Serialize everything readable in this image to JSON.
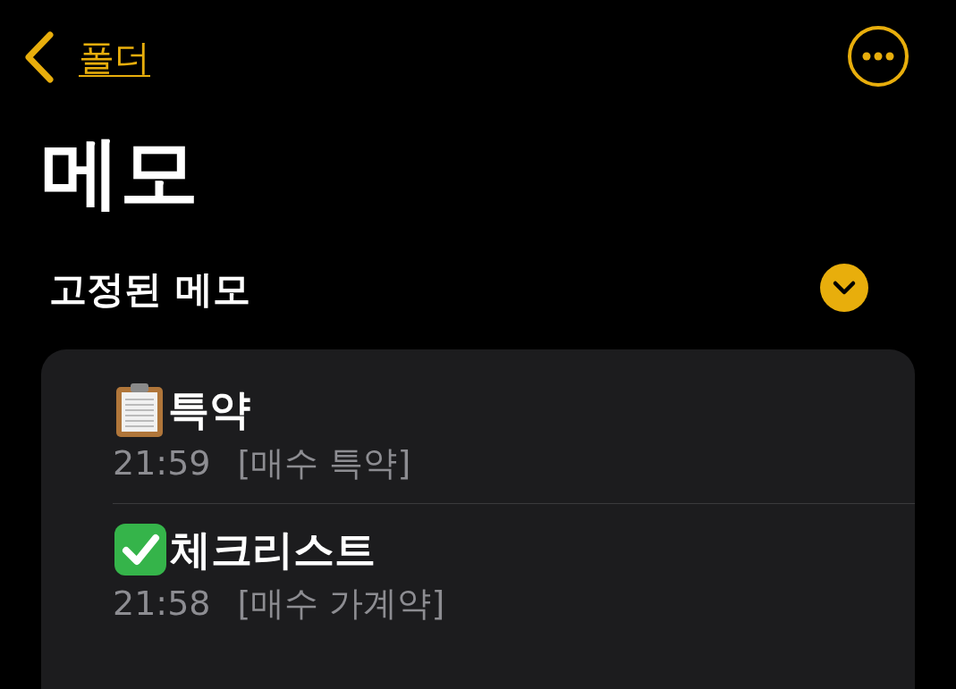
{
  "nav": {
    "back_label": "폴더"
  },
  "title": "메모",
  "section": {
    "title": "고정된 메모",
    "expanded": true
  },
  "notes": [
    {
      "kind": "clipboard",
      "title": "특약",
      "time": "21:59",
      "preview": "[매수 특약]"
    },
    {
      "kind": "checklist",
      "title": "체크리스트",
      "time": "21:58",
      "preview": "[매수 가계약]"
    }
  ]
}
